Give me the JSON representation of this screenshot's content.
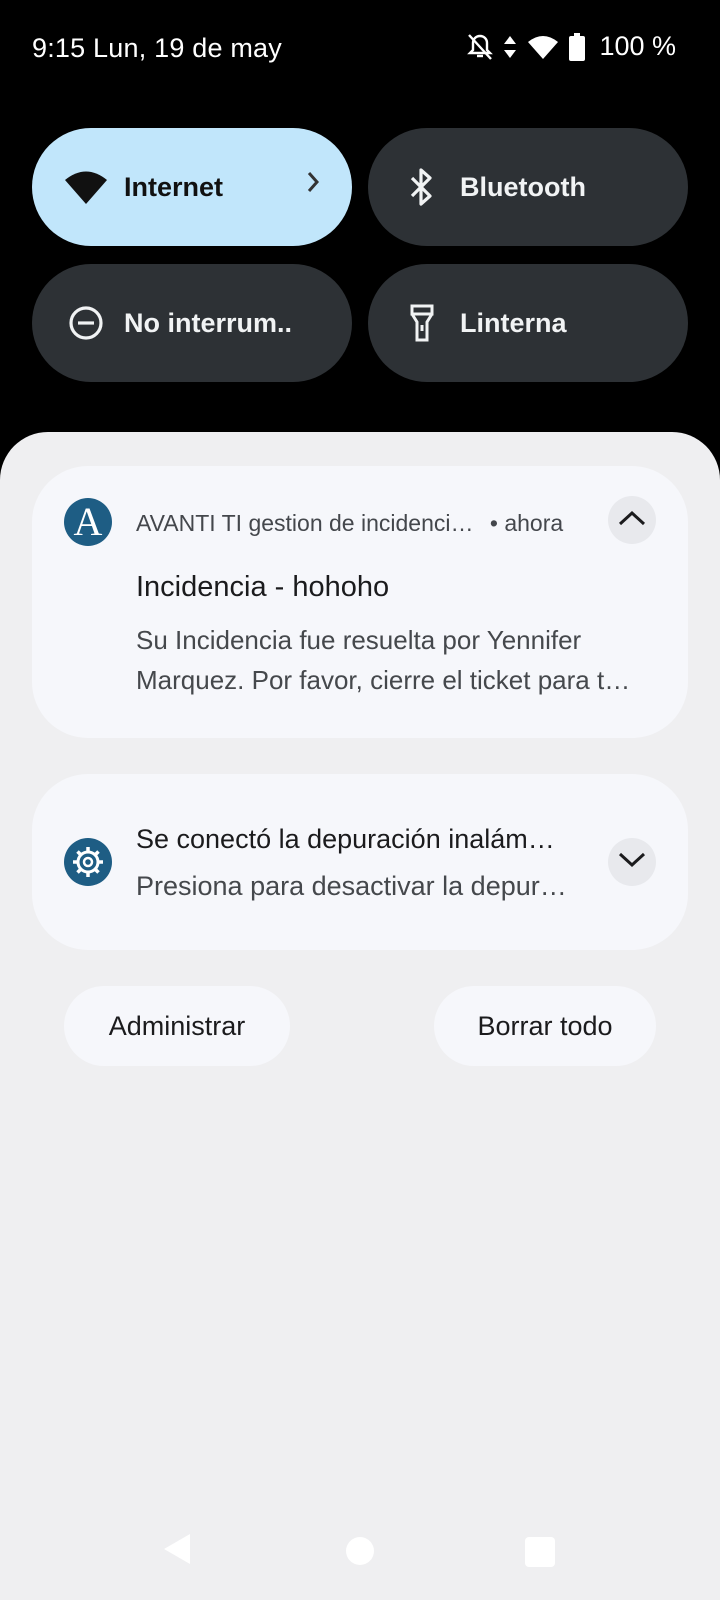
{
  "status_bar": {
    "time_date": "9:15 Lun, 19 de may",
    "battery_percent": "100 %",
    "icons": [
      "notifications-off-icon",
      "data-arrows-icon",
      "wifi-icon",
      "battery-icon"
    ]
  },
  "quick_settings": {
    "tiles": [
      {
        "label": "Internet",
        "icon": "wifi-icon",
        "active": true
      },
      {
        "label": "Bluetooth",
        "icon": "bluetooth-icon",
        "active": false
      },
      {
        "label": "No interrum..",
        "icon": "do-not-disturb-icon",
        "active": false
      },
      {
        "label": "Linterna",
        "icon": "flashlight-icon",
        "active": false
      }
    ]
  },
  "notifications": [
    {
      "app_letter": "A",
      "app_name": "AVANTI TI gestion de incidenci…",
      "time": "• ahora",
      "title": "Incidencia - hohoho",
      "body_line1": "Su Incidencia fue resuelta por Yennifer",
      "body_line2": "Marquez. Por favor, cierre el ticket para t…",
      "expanded": true
    },
    {
      "icon": "gear-icon",
      "title": "Se conectó la depuración inalám…",
      "body": "Presiona para desactivar la depur…",
      "expanded": false
    }
  ],
  "actions": {
    "manage": "Administrar",
    "clear_all": "Borrar todo"
  },
  "colors": {
    "accent_tile": "#c1e6fb",
    "inactive_tile": "#2d3135",
    "app_icon": "#1e5d84",
    "panel": "#efeff1",
    "card": "#f6f7fb"
  }
}
